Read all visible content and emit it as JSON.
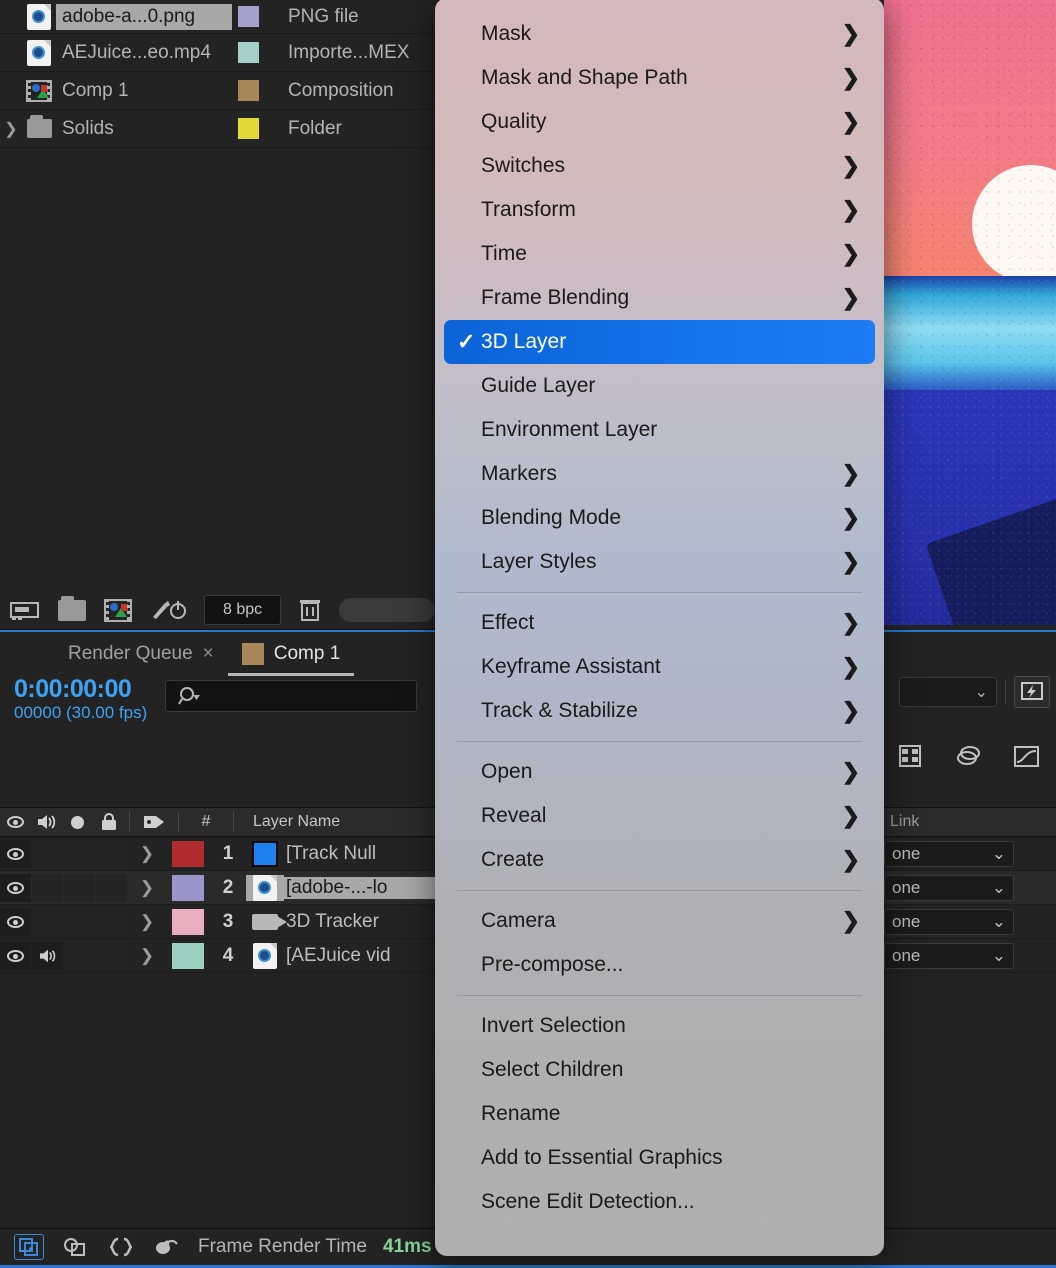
{
  "app": "Adobe After Effects",
  "project_panel": {
    "columns": [
      "Name",
      "Label",
      "Type"
    ],
    "items": [
      {
        "name": "adobe-a...0.png",
        "icon": "png-file-icon",
        "label_color": "#a5a1cd",
        "type": "PNG file",
        "selected": true,
        "expandable": false
      },
      {
        "name": "AEJuice...eo.mp4",
        "icon": "video-file-icon",
        "label_color": "#a7cfc9",
        "type": "Importe...MEX",
        "selected": false,
        "expandable": false
      },
      {
        "name": "Comp 1",
        "icon": "composition-icon",
        "label_color": "#a8875a",
        "type": "Composition",
        "selected": false,
        "expandable": false
      },
      {
        "name": "Solids",
        "icon": "folder-icon",
        "label_color": "#e2d935",
        "type": "Folder",
        "selected": false,
        "expandable": true
      }
    ],
    "footer": {
      "interpret_footage_label": "interpret-footage",
      "new_folder_label": "new-folder",
      "new_composition_label": "new-composition",
      "project_settings_label": "project-settings",
      "bit_depth": "8 bpc",
      "delete_label": "delete"
    }
  },
  "timeline": {
    "tabs": [
      {
        "label": "Render Queue",
        "active": false,
        "closable": true
      },
      {
        "label": "Comp 1",
        "active": true,
        "swatch": "#a8875a"
      }
    ],
    "close_glyph": "×",
    "timecode": "0:00:00:00",
    "frame_info": "00000 (30.00 fps)",
    "search_placeholder": "",
    "right_tools": {
      "renderer_dropdown_value": "",
      "fast_preview_label": "fast-previews"
    },
    "icon_row": [
      "film-icon",
      "layers-icon",
      "graph-editor-icon"
    ],
    "layer_columns": {
      "video": "eye-icon",
      "audio": "speaker-icon",
      "solo": "solo-icon",
      "lock": "lock-icon",
      "label": "tag-icon",
      "number": "#",
      "name": "Layer Name",
      "parent": "Link"
    },
    "layers": [
      {
        "num": "1",
        "name": "[Track Null ",
        "label_color": "#b02b2b",
        "icon": "null-object-icon",
        "video": true,
        "audio": false,
        "selected": false,
        "parent": "one"
      },
      {
        "num": "2",
        "name": "[adobe-...-lo",
        "label_color": "#9a96cc",
        "icon": "png-file-icon",
        "video": true,
        "audio": false,
        "selected": true,
        "parent": "one"
      },
      {
        "num": "3",
        "name": "3D Tracker ",
        "label_color": "#e8aebf",
        "icon": "camera-icon",
        "video": true,
        "audio": false,
        "selected": false,
        "parent": "one"
      },
      {
        "num": "4",
        "name": "[AEJuice vid",
        "label_color": "#9ed0c2",
        "icon": "video-file-icon",
        "video": true,
        "audio": true,
        "selected": false,
        "parent": "one"
      }
    ],
    "parent_dropdown_glyph": "⌄",
    "status_bar": {
      "icons": [
        "shy-layers-icon",
        "frame-blend-icon",
        "graph-expression-icon",
        "motion-blur-icon"
      ],
      "frame_render_label": "Frame Render Time",
      "frame_render_value": "41ms"
    }
  },
  "context_menu": {
    "highlight_color": "#1472ea",
    "checkmark": "✓",
    "submenu_arrow": "❯",
    "sections": [
      {
        "items": [
          {
            "label": "Mask",
            "submenu": true
          },
          {
            "label": "Mask and Shape Path",
            "submenu": true
          },
          {
            "label": "Quality",
            "submenu": true
          },
          {
            "label": "Switches",
            "submenu": true
          },
          {
            "label": "Transform",
            "submenu": true
          },
          {
            "label": "Time",
            "submenu": true
          },
          {
            "label": "Frame Blending",
            "submenu": true
          },
          {
            "label": "3D Layer",
            "submenu": false,
            "checked": true,
            "highlighted": true
          },
          {
            "label": "Guide Layer",
            "submenu": false
          },
          {
            "label": "Environment Layer",
            "submenu": false
          },
          {
            "label": "Markers",
            "submenu": true
          },
          {
            "label": "Blending Mode",
            "submenu": true
          },
          {
            "label": "Layer Styles",
            "submenu": true
          }
        ]
      },
      {
        "items": [
          {
            "label": "Effect",
            "submenu": true
          },
          {
            "label": "Keyframe Assistant",
            "submenu": true
          },
          {
            "label": "Track & Stabilize",
            "submenu": true
          }
        ]
      },
      {
        "items": [
          {
            "label": "Open",
            "submenu": true
          },
          {
            "label": "Reveal",
            "submenu": true
          },
          {
            "label": "Create",
            "submenu": true
          }
        ]
      },
      {
        "items": [
          {
            "label": "Camera",
            "submenu": true
          },
          {
            "label": "Pre-compose...",
            "submenu": false
          }
        ]
      },
      {
        "items": [
          {
            "label": "Invert Selection",
            "submenu": false
          },
          {
            "label": "Select Children",
            "submenu": false
          },
          {
            "label": "Rename",
            "submenu": false
          },
          {
            "label": "Add to Essential Graphics",
            "submenu": false
          },
          {
            "label": "Scene Edit Detection...",
            "submenu": false
          }
        ]
      }
    ]
  },
  "composition_preview": {
    "description": "beach-scene",
    "sky_color": "#f2798c",
    "sun_color": "#fdf8f2",
    "water_color": "#8fdcf2",
    "sea_color": "#2731ab",
    "rock_color": "#161c5e"
  }
}
